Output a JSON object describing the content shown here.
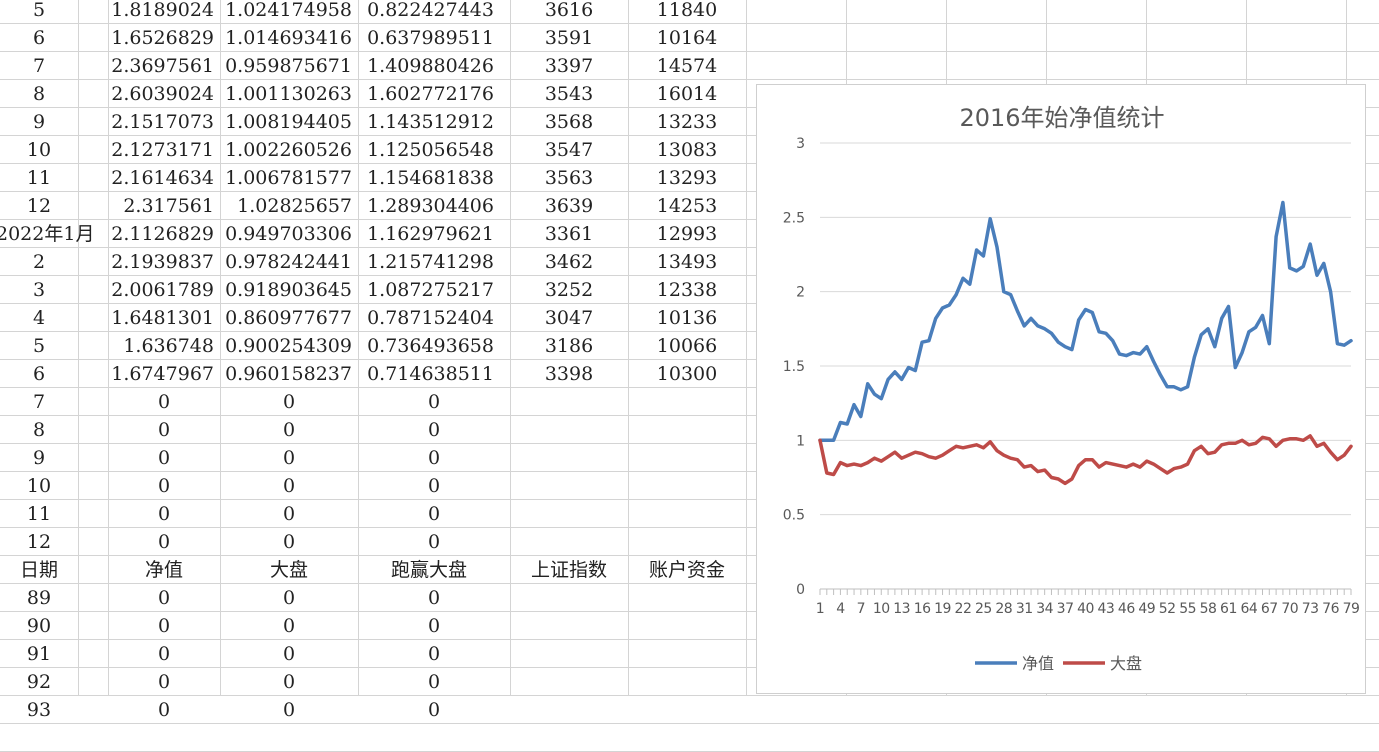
{
  "sheet": {
    "rows": [
      {
        "c0": "5",
        "c1": "1.8189024",
        "c2": "1.024174958",
        "c3": "0.822427443",
        "c4": "3616",
        "c5": "11840"
      },
      {
        "c0": "6",
        "c1": "1.6526829",
        "c2": "1.014693416",
        "c3": "0.637989511",
        "c4": "3591",
        "c5": "10164"
      },
      {
        "c0": "7",
        "c1": "2.3697561",
        "c2": "0.959875671",
        "c3": "1.409880426",
        "c4": "3397",
        "c5": "14574"
      },
      {
        "c0": "8",
        "c1": "2.6039024",
        "c2": "1.001130263",
        "c3": "1.602772176",
        "c4": "3543",
        "c5": "16014"
      },
      {
        "c0": "9",
        "c1": "2.1517073",
        "c2": "1.008194405",
        "c3": "1.143512912",
        "c4": "3568",
        "c5": "13233"
      },
      {
        "c0": "10",
        "c1": "2.1273171",
        "c2": "1.002260526",
        "c3": "1.125056548",
        "c4": "3547",
        "c5": "13083"
      },
      {
        "c0": "11",
        "c1": "2.1614634",
        "c2": "1.006781577",
        "c3": "1.154681838",
        "c4": "3563",
        "c5": "13293"
      },
      {
        "c0": "12",
        "c1": "2.317561",
        "c2": "1.02825657",
        "c3": "1.289304406",
        "c4": "3639",
        "c5": "14253"
      },
      {
        "c0": "2022年1月",
        "c1": "2.1126829",
        "c2": "0.949703306",
        "c3": "1.162979621",
        "c4": "3361",
        "c5": "12993"
      },
      {
        "c0": "2",
        "c1": "2.1939837",
        "c2": "0.978242441",
        "c3": "1.215741298",
        "c4": "3462",
        "c5": "13493"
      },
      {
        "c0": "3",
        "c1": "2.0061789",
        "c2": "0.918903645",
        "c3": "1.087275217",
        "c4": "3252",
        "c5": "12338"
      },
      {
        "c0": "4",
        "c1": "1.6481301",
        "c2": "0.860977677",
        "c3": "0.787152404",
        "c4": "3047",
        "c5": "10136"
      },
      {
        "c0": "5",
        "c1": "1.636748",
        "c2": "0.900254309",
        "c3": "0.736493658",
        "c4": "3186",
        "c5": "10066"
      },
      {
        "c0": "6",
        "c1": "1.6747967",
        "c2": "0.960158237",
        "c3": "0.714638511",
        "c4": "3398",
        "c5": "10300"
      }
    ],
    "zero_rows": [
      {
        "c0": "7",
        "c1": "0",
        "c2": "0",
        "c3": "0"
      },
      {
        "c0": "8",
        "c1": "0",
        "c2": "0",
        "c3": "0"
      },
      {
        "c0": "9",
        "c1": "0",
        "c2": "0",
        "c3": "0"
      },
      {
        "c0": "10",
        "c1": "0",
        "c2": "0",
        "c3": "0"
      },
      {
        "c0": "11",
        "c1": "0",
        "c2": "0",
        "c3": "0"
      },
      {
        "c0": "12",
        "c1": "0",
        "c2": "0",
        "c3": "0"
      }
    ],
    "header": {
      "c0": "日期",
      "c1": "净值",
      "c2": "大盘",
      "c3": "跑赢大盘",
      "c4": "上证指数",
      "c5": "账户资金"
    },
    "bottom_rows": [
      {
        "c0": "89",
        "c1": "0",
        "c2": "0",
        "c3": "0"
      },
      {
        "c0": "90",
        "c1": "0",
        "c2": "0",
        "c3": "0"
      },
      {
        "c0": "91",
        "c1": "0",
        "c2": "0",
        "c3": "0"
      },
      {
        "c0": "92",
        "c1": "0",
        "c2": "0",
        "c3": "0"
      },
      {
        "c0": "93",
        "c1": "0",
        "c2": "0",
        "c3": "0"
      }
    ]
  },
  "chart_data": {
    "type": "line",
    "title": "2016年始净值统计",
    "ylim": [
      0,
      3
    ],
    "yticks": [
      "0",
      "0.5",
      "1",
      "1.5",
      "2",
      "2.5",
      "3"
    ],
    "xticks_labeled": [
      "1",
      "4",
      "7",
      "10",
      "13",
      "16",
      "19",
      "22",
      "25",
      "28",
      "31",
      "34",
      "37",
      "40",
      "43",
      "46",
      "49",
      "52",
      "55",
      "58",
      "61",
      "64",
      "67",
      "70",
      "73",
      "76",
      "79"
    ],
    "x_count": 79,
    "grid": true,
    "legend_position": "bottom",
    "series": [
      {
        "name": "净值",
        "color": "#4a7ebb",
        "values": [
          1.0,
          1.0,
          1.0,
          1.12,
          1.11,
          1.24,
          1.16,
          1.38,
          1.31,
          1.28,
          1.41,
          1.46,
          1.41,
          1.49,
          1.47,
          1.66,
          1.67,
          1.82,
          1.89,
          1.91,
          1.98,
          2.09,
          2.05,
          2.28,
          2.24,
          2.49,
          2.3,
          2.0,
          1.98,
          1.87,
          1.77,
          1.82,
          1.77,
          1.75,
          1.72,
          1.66,
          1.63,
          1.61,
          1.81,
          1.88,
          1.86,
          1.73,
          1.72,
          1.67,
          1.58,
          1.57,
          1.59,
          1.58,
          1.63,
          1.53,
          1.44,
          1.36,
          1.36,
          1.34,
          1.36,
          1.56,
          1.71,
          1.75,
          1.63,
          1.82,
          1.9,
          1.49,
          1.59,
          1.73,
          1.76,
          1.84,
          1.65,
          2.37,
          2.6,
          2.16,
          2.14,
          2.17,
          2.32,
          2.11,
          2.19,
          2.0,
          1.65,
          1.64,
          1.67
        ]
      },
      {
        "name": "大盘",
        "color": "#be4b48",
        "values": [
          1.0,
          0.78,
          0.77,
          0.85,
          0.83,
          0.84,
          0.83,
          0.85,
          0.88,
          0.86,
          0.89,
          0.92,
          0.88,
          0.9,
          0.92,
          0.91,
          0.89,
          0.88,
          0.9,
          0.93,
          0.96,
          0.95,
          0.96,
          0.97,
          0.95,
          0.99,
          0.93,
          0.9,
          0.88,
          0.87,
          0.82,
          0.83,
          0.79,
          0.8,
          0.75,
          0.74,
          0.71,
          0.74,
          0.83,
          0.87,
          0.87,
          0.82,
          0.85,
          0.84,
          0.83,
          0.82,
          0.84,
          0.82,
          0.86,
          0.84,
          0.81,
          0.78,
          0.81,
          0.82,
          0.84,
          0.93,
          0.96,
          0.91,
          0.92,
          0.97,
          0.98,
          0.98,
          1.0,
          0.97,
          0.98,
          1.02,
          1.01,
          0.96,
          1.0,
          1.01,
          1.01,
          1.0,
          1.03,
          0.96,
          0.98,
          0.92,
          0.87,
          0.9,
          0.96
        ]
      }
    ]
  }
}
